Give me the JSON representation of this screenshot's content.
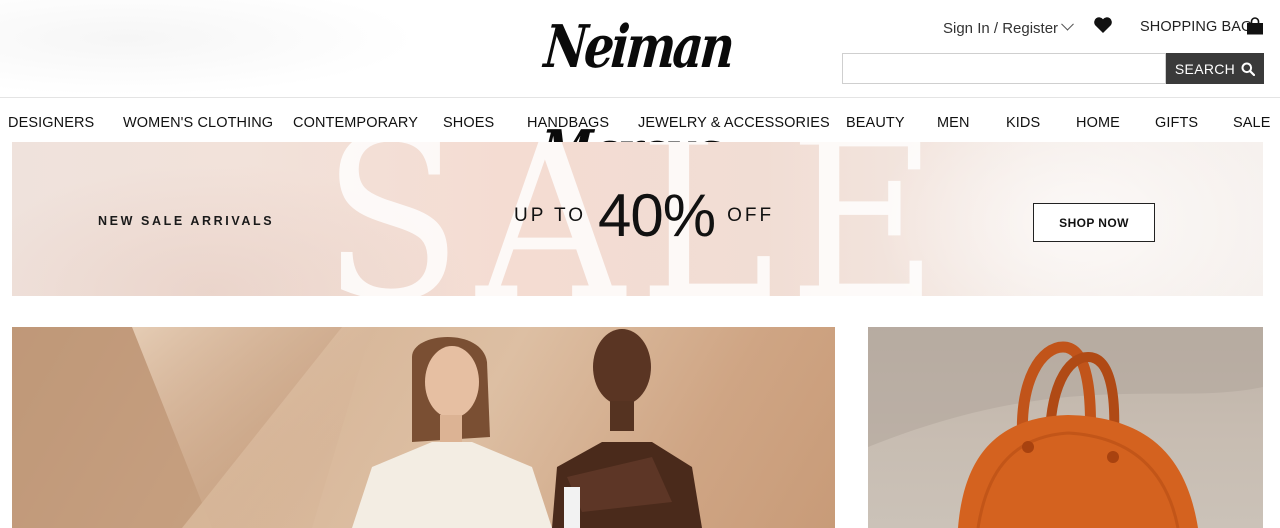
{
  "header": {
    "logo_text": "Neiman Marcus",
    "account_label": "Sign In / Register",
    "favorites_icon": "heart-icon",
    "bag_label": "SHOPPING BAG",
    "bag_icon": "shopping-bag-icon",
    "search": {
      "value": "",
      "placeholder": "",
      "button_label": "SEARCH",
      "icon": "magnifier-icon"
    }
  },
  "nav": {
    "items": [
      {
        "label": "DESIGNERS"
      },
      {
        "label": "WOMEN'S CLOTHING"
      },
      {
        "label": "CONTEMPORARY"
      },
      {
        "label": "SHOES"
      },
      {
        "label": "HANDBAGS"
      },
      {
        "label": "JEWELRY & ACCESSORIES"
      },
      {
        "label": "BEAUTY"
      },
      {
        "label": "MEN"
      },
      {
        "label": "KIDS"
      },
      {
        "label": "HOME"
      },
      {
        "label": "GIFTS"
      },
      {
        "label": "SALE"
      }
    ]
  },
  "banner": {
    "background_word": "SALE",
    "left_text": "NEW SALE ARRIVALS",
    "offer_prefix": "UP TO",
    "offer_value": "40%",
    "offer_suffix": "OFF",
    "cta_label": "SHOP NOW"
  },
  "colors": {
    "search_button": "#3a3a3a",
    "text": "#111111",
    "banner_bg": "#f2e0d7"
  }
}
